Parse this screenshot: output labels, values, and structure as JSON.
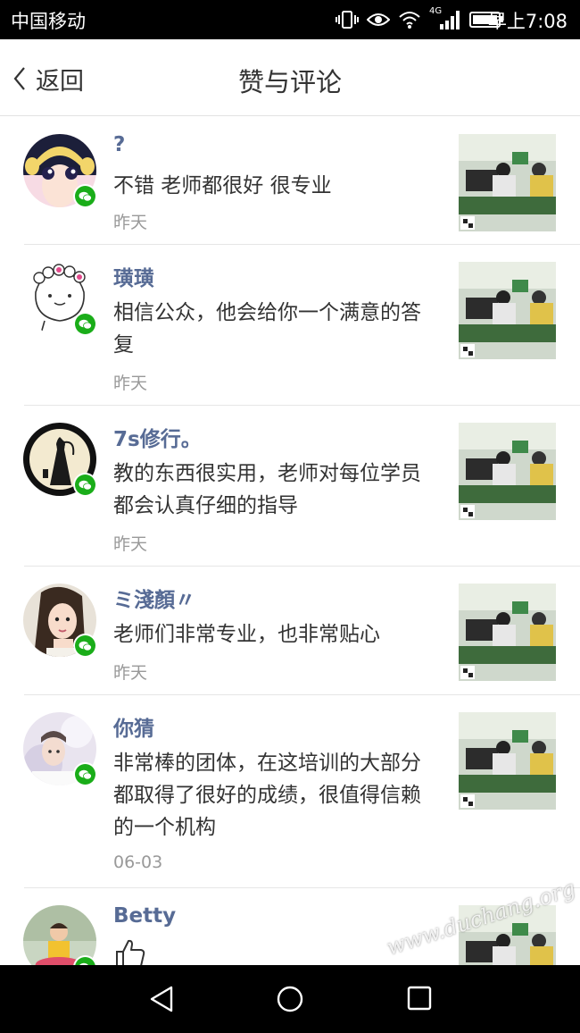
{
  "status_bar": {
    "carrier": "中国移动",
    "network": "4G",
    "time": "早上7:08"
  },
  "header": {
    "back_label": "返回",
    "title": "赞与评论"
  },
  "items": [
    {
      "name": "?",
      "comment": "不错 老师都很好 很专业",
      "time": "昨天"
    },
    {
      "name": "璜璜",
      "comment": "相信公众，他会给你一个满意的答复",
      "time": "昨天"
    },
    {
      "name": "7s修行。",
      "comment": "教的东西很实用，老师对每位学员都会认真仔细的指导",
      "time": "昨天"
    },
    {
      "name": "ミ淺顏〃",
      "comment": "老师们非常专业，也非常贴心",
      "time": "昨天"
    },
    {
      "name": "你猜",
      "comment": "非常棒的团体，在这培训的大部分都取得了很好的成绩，很值得信赖的一个机构",
      "time": "06-03"
    },
    {
      "name": "Betty",
      "like_icon": "thumbs-up-icon"
    }
  ],
  "watermark": "www.duchang.org",
  "colors": {
    "name": "#576b95",
    "wechat_badge": "#1aad19",
    "time": "#999999"
  }
}
